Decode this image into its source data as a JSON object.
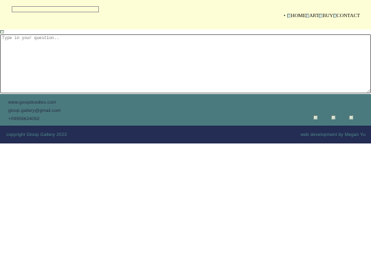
{
  "header": {
    "nav": [
      {
        "label": "HOME"
      },
      {
        "label": "ART"
      },
      {
        "label": "BUY"
      },
      {
        "label": "CONTACT"
      }
    ]
  },
  "question": {
    "placeholder": "Type in your question.."
  },
  "contact": {
    "website": "www.goopdoodles.com",
    "email": "gloop.gallery@gmail.com",
    "phone": "+09959624050"
  },
  "footer": {
    "copyright": "copyright Gloop Gallery 2023",
    "credit": "web development by Megan Yu"
  },
  "colors": {
    "header_bg": "#fefed6",
    "contact_bg": "#4b7a7e",
    "footer_bg": "#242d53"
  }
}
